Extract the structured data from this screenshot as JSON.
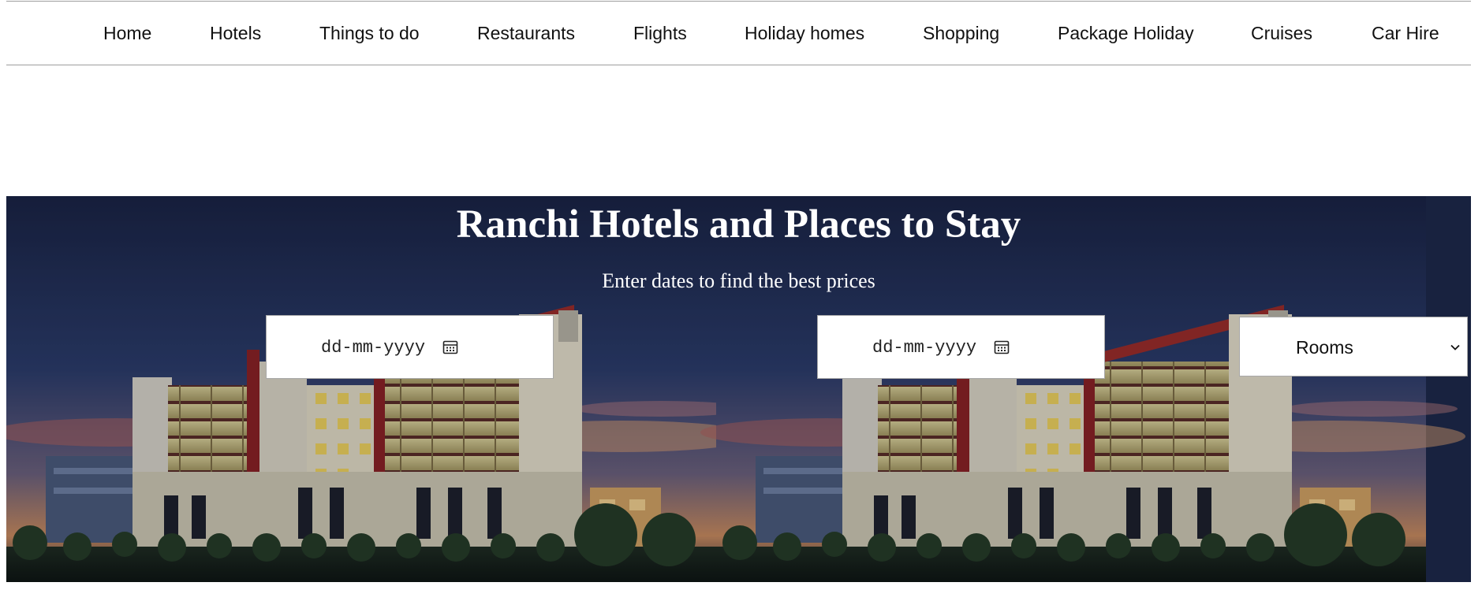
{
  "nav": {
    "items": [
      {
        "label": "Home"
      },
      {
        "label": "Hotels"
      },
      {
        "label": "Things to do"
      },
      {
        "label": "Restaurants"
      },
      {
        "label": "Flights"
      },
      {
        "label": "Holiday homes"
      },
      {
        "label": "Shopping"
      },
      {
        "label": "Package Holiday"
      },
      {
        "label": "Cruises"
      },
      {
        "label": "Car Hire"
      }
    ]
  },
  "hero": {
    "title": "Ranchi Hotels and Places to Stay",
    "subtitle": "Enter dates to find the best prices",
    "checkin": {
      "placeholder": "dd-mm-yyyy",
      "icon": "calendar-icon"
    },
    "checkout": {
      "placeholder": "dd-mm-yyyy",
      "icon": "calendar-icon"
    },
    "rooms": {
      "selected": "Rooms",
      "icon": "chevron-down-icon"
    }
  }
}
